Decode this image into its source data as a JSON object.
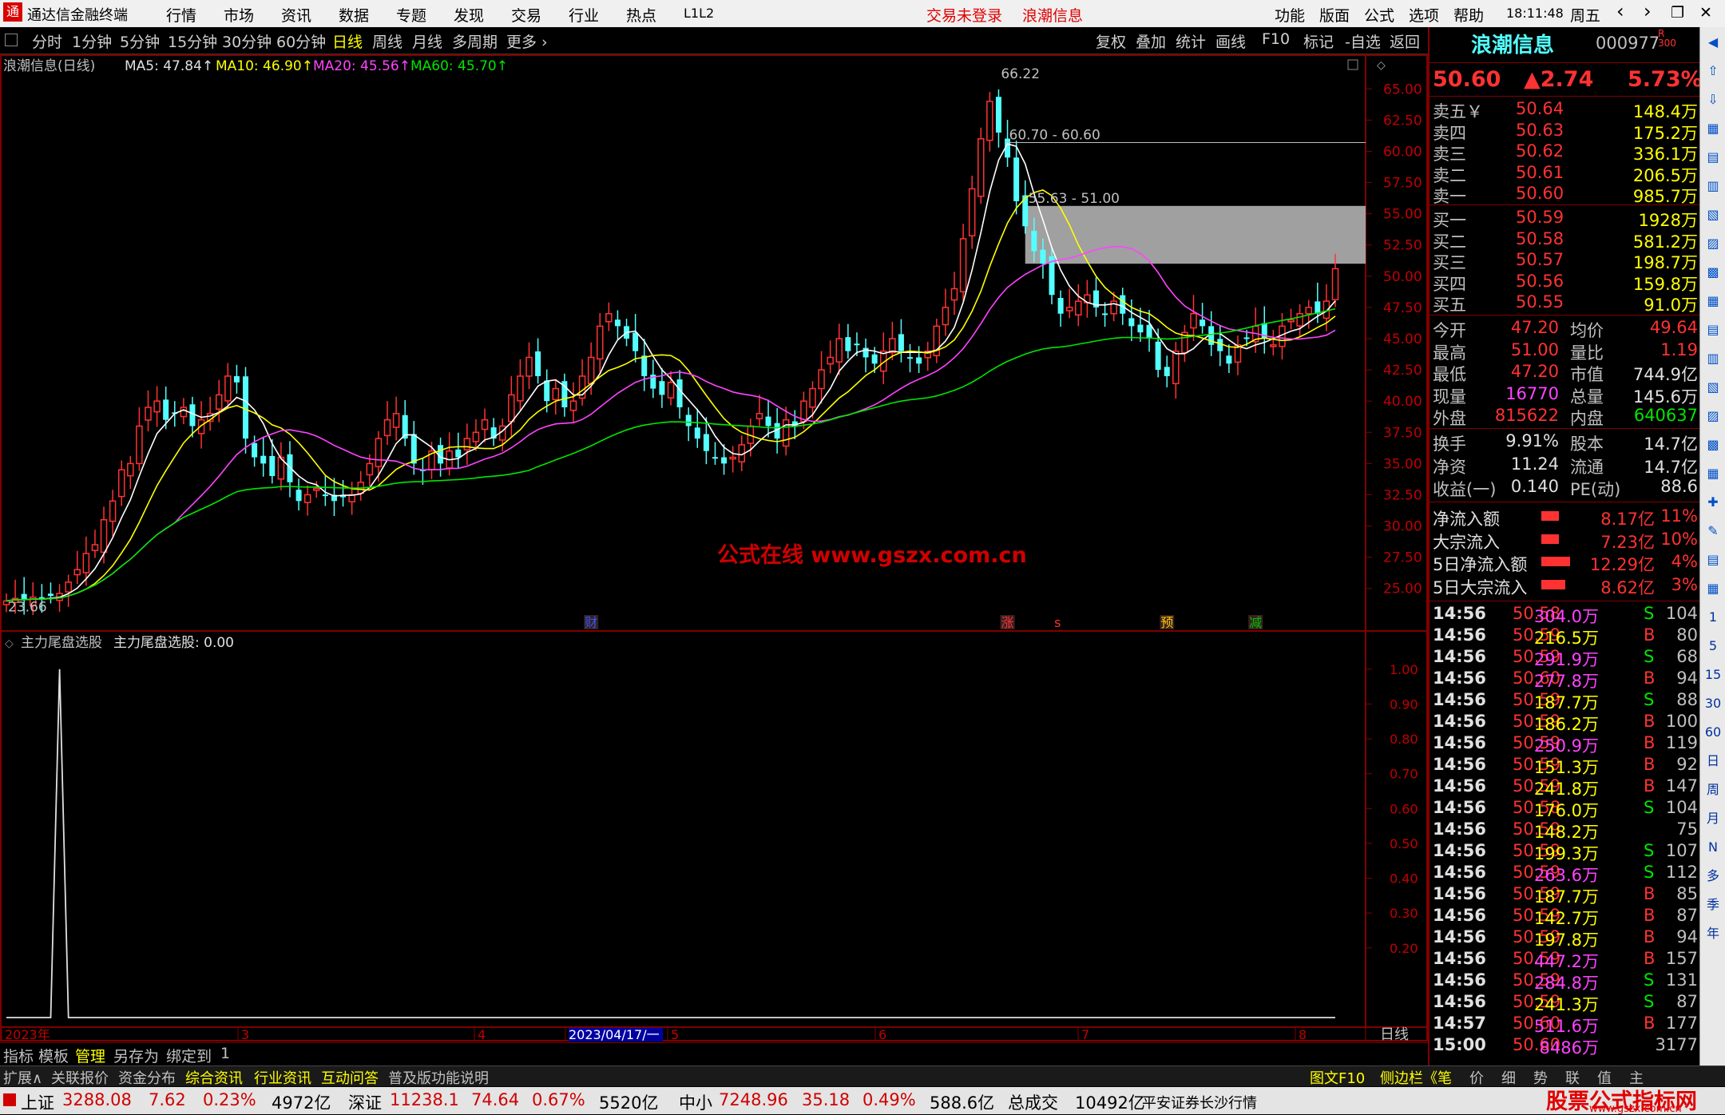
{
  "title": {
    "app": "通达信金融终端",
    "menu": [
      "行情",
      "市场",
      "资讯",
      "数据",
      "专题",
      "发现",
      "交易",
      "行业",
      "热点",
      "L1L2"
    ],
    "notice": "交易未登录",
    "stock": "浪潮信息",
    "right_menu": [
      "功能",
      "版面",
      "公式",
      "选项",
      "帮助"
    ],
    "time": "18:11:48",
    "weekday": "周五",
    "win_ctrls": [
      "‹",
      "›",
      "❐",
      "✕"
    ]
  },
  "toolbar": {
    "periods": [
      "分时",
      "1分钟",
      "5分钟",
      "15分钟",
      "30分钟",
      "60分钟",
      "日线",
      "周线",
      "月线",
      "多周期",
      "更多 ›"
    ],
    "selected": "日线",
    "tools": [
      "复权",
      "叠加",
      "统计",
      "画线",
      "F10",
      "标记",
      "-自选",
      "返回"
    ]
  },
  "main_chart": {
    "name": "浪潮信息(日线)",
    "ma5": "MA5: 47.84↑",
    "ma10": "MA10: 46.90↑",
    "ma20": "MA20: 45.56↑",
    "ma60": "MA60: 45.70↑",
    "watermark": "公式在线  www.gszx.com.cn",
    "annot_high": "66.22",
    "annot_line1": "60.70 - 60.60",
    "annot_line2": "55.63 - 51.00",
    "annot_low": "23.66",
    "events": [
      "财",
      "涨",
      "s",
      "预",
      "减"
    ],
    "y_labels": [
      "65.00",
      "62.50",
      "60.00",
      "57.50",
      "55.00",
      "52.50",
      "50.00",
      "47.50",
      "45.00",
      "42.50",
      "40.00",
      "37.50",
      "35.00",
      "32.50",
      "30.00",
      "27.50",
      "25.00"
    ]
  },
  "chart_data": [
    {
      "type": "candlestick",
      "title": "浪潮信息(日线)",
      "ylim": [
        23,
        67
      ],
      "y_ticks": [
        65,
        62.5,
        60,
        57.5,
        55,
        52.5,
        50,
        47.5,
        45,
        42.5,
        40,
        37.5,
        35,
        32.5,
        30,
        27.5,
        25
      ],
      "series": [
        {
          "name": "MA5",
          "value": 47.84
        },
        {
          "name": "MA10",
          "value": 46.9
        },
        {
          "name": "MA20",
          "value": 45.56
        },
        {
          "name": "MA60",
          "value": 45.7
        }
      ],
      "high": 66.22,
      "low": 23.66,
      "last_close": 50.6,
      "closes": [
        24.0,
        24.2,
        24.1,
        24.3,
        24.1,
        24.4,
        24.6,
        25.5,
        26.5,
        27.8,
        28.5,
        30.5,
        32.0,
        34.5,
        35.0,
        38.0,
        39.5,
        40.0,
        38.5,
        39.0,
        39.5,
        38.0,
        38.5,
        39.0,
        40.5,
        42.0,
        41.5,
        37.0,
        35.5,
        35.0,
        34.0,
        35.5,
        33.5,
        32.0,
        32.5,
        33.0,
        32.5,
        32.0,
        32.3,
        32.5,
        33.5,
        35.0,
        37.0,
        38.5,
        39.0,
        37.0,
        35.0,
        34.5,
        36.0,
        35.0,
        36.0,
        35.5,
        37.0,
        37.5,
        38.5,
        37.0,
        38.0,
        40.5,
        42.0,
        43.5,
        42.0,
        40.0,
        41.0,
        39.5,
        40.0,
        42.0,
        43.5,
        46.0,
        47.0,
        46.0,
        45.0,
        44.0,
        42.0,
        41.0,
        40.5,
        41.5,
        39.5,
        38.0,
        37.0,
        36.0,
        35.5,
        35.0,
        35.5,
        36.5,
        38.0,
        39.0,
        38.0,
        37.0,
        38.5,
        38.0,
        40.0,
        41.0,
        42.5,
        43.5,
        45.0,
        44.0,
        44.5,
        43.5,
        43.0,
        44.0,
        45.0,
        44.0,
        43.5,
        43.0,
        44.0,
        46.0,
        47.5,
        49.0,
        53.0,
        57.0,
        61.0,
        64.0,
        61.5,
        59.5,
        56.0,
        54.0,
        52.0,
        51.0,
        48.5,
        47.0,
        47.5,
        48.0,
        48.5,
        47.5,
        47.0,
        48.0,
        47.0,
        46.0,
        45.5,
        45.0,
        42.5,
        42.0,
        44.0,
        45.5,
        47.0,
        46.0,
        44.5,
        44.0,
        43.0,
        44.5,
        45.0,
        46.0,
        45.0,
        44.5,
        46.0,
        46.5,
        47.0,
        47.5,
        47.0,
        48.0,
        50.6
      ]
    },
    {
      "type": "line",
      "title": "主力尾盘选股",
      "value": 0.0,
      "ylim": [
        0,
        1.05
      ],
      "y_ticks": [
        1.0,
        0.9,
        0.8,
        0.7,
        0.6,
        0.5,
        0.4,
        0.3,
        0.2
      ],
      "spike_at_index": 6
    }
  ],
  "sub_chart": {
    "title": "主力尾盘选股",
    "value_label": "主力尾盘选股: 0.00",
    "y_labels": [
      "1.00",
      "0.90",
      "0.80",
      "0.70",
      "0.60",
      "0.50",
      "0.40",
      "0.30",
      "0.20"
    ],
    "x_labels": [
      "2023年",
      "3",
      "4",
      "2023/04/17/一",
      "5",
      "6",
      "7",
      "8"
    ],
    "period": "日线",
    "plus": "+",
    "minus": "−"
  },
  "quote": {
    "name": "浪潮信息",
    "code": "000977",
    "badge": "R\n300",
    "price": "50.60",
    "change": "▲2.74",
    "pct": "5.73%",
    "sells": [
      {
        "label": "卖五￥",
        "price": "50.64",
        "vol": "148.4万"
      },
      {
        "label": "卖四",
        "price": "50.63",
        "vol": "175.2万"
      },
      {
        "label": "卖三",
        "price": "50.62",
        "vol": "336.1万"
      },
      {
        "label": "卖二",
        "price": "50.61",
        "vol": "206.5万"
      },
      {
        "label": "卖一",
        "price": "50.60",
        "vol": "985.7万"
      }
    ],
    "buys": [
      {
        "label": "买一",
        "price": "50.59",
        "vol": "1928万"
      },
      {
        "label": "买二",
        "price": "50.58",
        "vol": "581.2万"
      },
      {
        "label": "买三",
        "price": "50.57",
        "vol": "198.7万"
      },
      {
        "label": "买四",
        "price": "50.56",
        "vol": "159.8万"
      },
      {
        "label": "买五",
        "price": "50.55",
        "vol": "91.0万"
      }
    ],
    "stats": [
      {
        "l1": "今开",
        "v1": "47.20",
        "l2": "均价",
        "v2": "49.64"
      },
      {
        "l1": "最高",
        "v1": "51.00",
        "l2": "量比",
        "v2": "1.19"
      },
      {
        "l1": "最低",
        "v1": "47.20",
        "l2": "市值",
        "v2": "744.9亿"
      },
      {
        "l1": "现量",
        "v1": "16770",
        "l2": "总量",
        "v2": "145.6万"
      },
      {
        "l1": "外盘",
        "v1": "815622",
        "l2": "内盘",
        "v2": "640637"
      }
    ],
    "stats2": [
      {
        "l1": "换手",
        "v1": "9.91%",
        "l2": "股本",
        "v2": "14.7亿"
      },
      {
        "l1": "净资",
        "v1": "11.24",
        "l2": "流通",
        "v2": "14.7亿"
      },
      {
        "l1": "收益(一)",
        "v1": "0.140",
        "l2": "PE(动)",
        "v2": "88.6"
      }
    ],
    "flows": [
      {
        "label": "净流入额",
        "value": "8.17亿",
        "pct": "11%"
      },
      {
        "label": "大宗流入",
        "value": "7.23亿",
        "pct": "10%"
      },
      {
        "label": "5日净流入额",
        "value": "12.29亿",
        "pct": "4%"
      },
      {
        "label": "5日大宗流入",
        "value": "8.62亿",
        "pct": "3%"
      }
    ],
    "ticks": [
      [
        "14:56",
        "50.58",
        "304.0万",
        "S",
        "104"
      ],
      [
        "14:56",
        "50.59",
        "216.5万",
        "B",
        "80"
      ],
      [
        "14:56",
        "50.59",
        "291.9万",
        "S",
        "68"
      ],
      [
        "14:56",
        "50.60",
        "277.8万",
        "B",
        "94"
      ],
      [
        "14:56",
        "50.59",
        "187.7万",
        "S",
        "88"
      ],
      [
        "14:56",
        "50.59",
        "186.2万",
        "B",
        "100"
      ],
      [
        "14:56",
        "50.59",
        "250.9万",
        "B",
        "119"
      ],
      [
        "14:56",
        "50.59",
        "151.3万",
        "B",
        "92"
      ],
      [
        "14:56",
        "50.59",
        "241.8万",
        "B",
        "147"
      ],
      [
        "14:56",
        "50.58",
        "176.0万",
        "S",
        "104"
      ],
      [
        "14:56",
        "50.59",
        "148.2万",
        "",
        "75"
      ],
      [
        "14:56",
        "50.59",
        "199.3万",
        "S",
        "107"
      ],
      [
        "14:56",
        "50.59",
        "263.6万",
        "S",
        "112"
      ],
      [
        "14:56",
        "50.59",
        "187.7万",
        "B",
        "85"
      ],
      [
        "14:56",
        "50.59",
        "142.7万",
        "B",
        "87"
      ],
      [
        "14:56",
        "50.59",
        "197.8万",
        "B",
        "94"
      ],
      [
        "14:56",
        "50.59",
        "447.2万",
        "B",
        "157"
      ],
      [
        "14:56",
        "50.59",
        "284.8万",
        "S",
        "131"
      ],
      [
        "14:56",
        "50.59",
        "241.3万",
        "S",
        "87"
      ],
      [
        "14:57",
        "50.60",
        "511.6万",
        "B",
        "177"
      ],
      [
        "15:00",
        "50.60",
        "8486万",
        "",
        "3177"
      ]
    ]
  },
  "right_icons": [
    "◀",
    "⇧",
    "⇩",
    "▦",
    "▤",
    "▥",
    "▧",
    "▨",
    "▩",
    "▦",
    "▤",
    "▥",
    "▧",
    "▨",
    "▩",
    "▦",
    "✚",
    "✎",
    "▤",
    "▦",
    "1",
    "5",
    "15",
    "30",
    "60",
    "日",
    "周",
    "月",
    "N",
    "多",
    "季",
    "年"
  ],
  "bottom_tabs": [
    "指标",
    "模板",
    "管理",
    "另存为",
    "绑定到",
    "1"
  ],
  "bottom_links": [
    "扩展∧",
    "关联报价",
    "资金分布",
    "综合资讯",
    "行业资讯",
    "互动问答",
    "普及版功能说明"
  ],
  "bottom_right": [
    "图文F10",
    "侧边栏《",
    "笔",
    "价",
    "细",
    "势",
    "联",
    "值",
    "主"
  ],
  "status": {
    "sh_label": "上证",
    "sh_val": "3288.08",
    "sh_chg": "7.62",
    "sh_pct": "0.23%",
    "sh_amt": "4972亿",
    "sz_label": "深证",
    "sz_val": "11238.1",
    "sz_chg": "74.64",
    "sz_pct": "0.67%",
    "sz_amt": "5520亿",
    "zx_label": "中小",
    "zx_val": "7248.96",
    "zx_chg": "35.18",
    "zx_pct": "0.49%",
    "zx_amt": "588.6亿",
    "total_label": "总成交",
    "total_val": "10492亿",
    "broker": "平安证券长沙行情",
    "brand": "股票公式指标网",
    "brand_url": "www.gszx.com.cn"
  },
  "colors": {
    "up": "#ff3232",
    "down": "#54ffff",
    "ma5": "#ffffff",
    "ma10": "#ffff00",
    "ma20": "#ff44ff",
    "ma60": "#00e600",
    "border": "#800000"
  }
}
